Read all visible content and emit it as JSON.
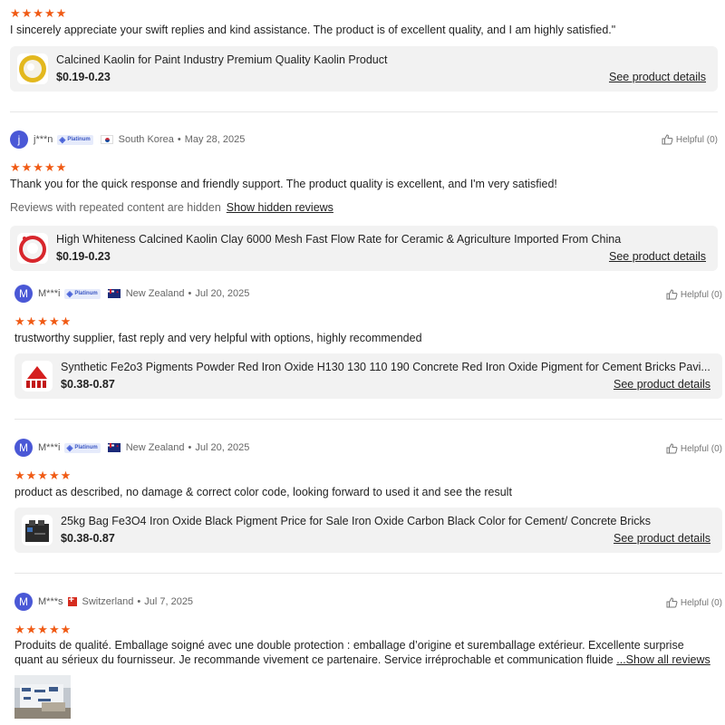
{
  "colors": {
    "star": "#f05a14",
    "avatar": "#4a58d6",
    "card_bg": "#f2f2f2"
  },
  "rating_stars": "★★★★★",
  "top_review": {
    "text": "I sincerely appreciate your swift replies and kind assistance. The product is of excellent quality, and I am highly satisfied.\"",
    "product": {
      "title": "Calcined Kaolin for Paint Industry Premium Quality Kaolin Product",
      "price": "$0.19-0.23",
      "details_label": "See product details",
      "thumb_icon": "white-powder-bowl-icon"
    }
  },
  "reviews": [
    {
      "avatar": "j",
      "user": "j***n",
      "badge": "Platinum",
      "flag_icon": "south-korea-flag-icon",
      "country": "South Korea",
      "date": "May 28, 2025",
      "helpful": "Helpful (0)",
      "text": "Thank you for the quick response and friendly support. The product quality is excellent, and I'm very satisfied!",
      "hidden_note": "Reviews with repeated content are hidden",
      "hidden_link": "Show hidden reviews",
      "product": {
        "title": "High Whiteness Calcined Kaolin Clay 6000 Mesh Fast Flow Rate for Ceramic & Agriculture Imported From China",
        "price": "$0.19-0.23",
        "details_label": "See product details",
        "thumb_icon": "white-powder-red-dish-icon"
      }
    },
    {
      "avatar": "M",
      "user": "M***i",
      "badge": "Platinum",
      "flag_icon": "new-zealand-flag-icon",
      "country": "New Zealand",
      "date": "Jul 20, 2025",
      "helpful": "Helpful (0)",
      "text": "trustworthy supplier, fast reply and very helpful with options, highly recommended",
      "product": {
        "title": "Synthetic Fe2o3 Pigments Powder Red Iron Oxide H130 130 110 190 Concrete Red Iron Oxide Pigment for Cement Bricks Pavi...",
        "price": "$0.38-0.87",
        "details_label": "See product details",
        "thumb_icon": "red-pigment-pile-icon"
      }
    },
    {
      "avatar": "M",
      "user": "M***i",
      "badge": "Platinum",
      "flag_icon": "new-zealand-flag-icon",
      "country": "New Zealand",
      "date": "Jul 20, 2025",
      "helpful": "Helpful (0)",
      "text": "product as described, no damage & correct color code, looking forward to used it and see the result",
      "product": {
        "title": "25kg Bag Fe3O4 Iron Oxide Black Pigment Price for Sale Iron Oxide Carbon Black Color for Cement/ Concrete Bricks",
        "price": "$0.38-0.87",
        "details_label": "See product details",
        "thumb_icon": "black-pigment-bags-icon"
      }
    },
    {
      "avatar": "M",
      "user": "M***s",
      "flag_icon": "switzerland-flag-icon",
      "country": "Switzerland",
      "date": "Jul 7, 2025",
      "helpful": "Helpful (0)",
      "text_line1": "Produits de qualité. Emballage soigné avec une double protection : emballage d’origine et suremballage extérieur. Excellente surprise",
      "text_line2": "quant au sérieux du fournisseur. Je recommande vivement ce partenaire. Service irréprochable et communication fluide",
      "show_all": "...Show all reviews",
      "photo_icon": "review-photo-thumbnail"
    }
  ]
}
